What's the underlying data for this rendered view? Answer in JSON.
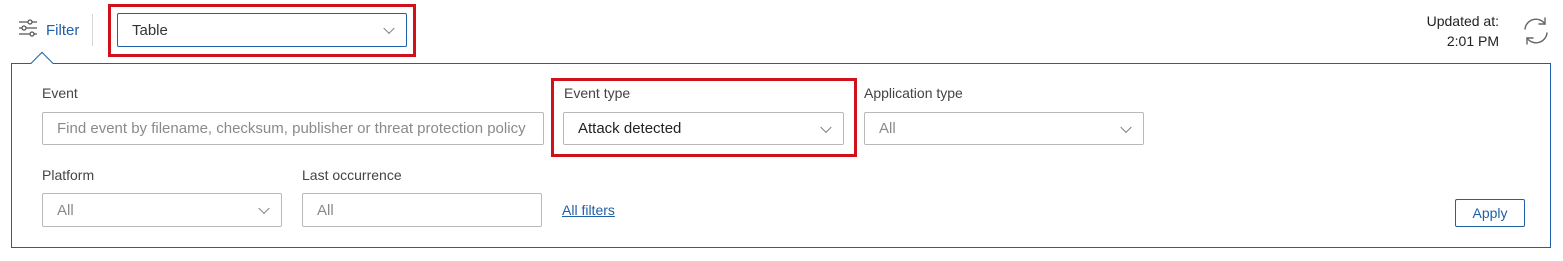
{
  "toolbar": {
    "filter_label": "Filter",
    "view_select_value": "Table",
    "updated_label": "Updated at:",
    "updated_time": "2:01 PM"
  },
  "filters": {
    "event": {
      "label": "Event",
      "placeholder": "Find event by filename, checksum, publisher or threat protection policy"
    },
    "event_type": {
      "label": "Event type",
      "value": "Attack detected"
    },
    "application_type": {
      "label": "Application type",
      "value": "All"
    },
    "platform": {
      "label": "Platform",
      "value": "All"
    },
    "last_occurrence": {
      "label": "Last occurrence",
      "value": "All"
    },
    "all_filters_link": "All filters",
    "apply_label": "Apply"
  },
  "colors": {
    "accent": "#1f5fa8",
    "highlight": "#d0101a"
  }
}
